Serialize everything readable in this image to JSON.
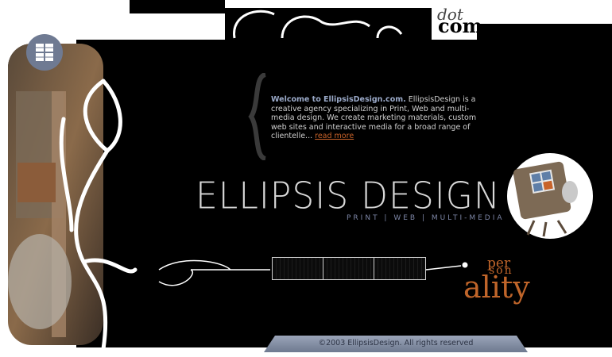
{
  "header": {
    "dot_text": "dot",
    "com_text": "com"
  },
  "welcome": {
    "bold_text": "Welcome to EllipsisDesign.com.",
    "body_text": " EllipsisDesign is a creative agency specializing in Print, Web and multi-media design. We create marketing materials, custom web sites and interactive media for a broad range of clientelle... ",
    "link_text": "read more"
  },
  "brand": {
    "name": "ELLIPSIS DESIGN",
    "tagline": "PRINT | WEB | MULTI-MEDIA"
  },
  "personality": {
    "line1": "per",
    "line2": "son",
    "line3": "ality"
  },
  "footer": {
    "copyright": "©2003 EllipsisDesign. All rights reserved"
  },
  "icons": {
    "menu": "grid-window-icon",
    "bracket": "curly-brace-icon",
    "robot": "robot-box-icon"
  },
  "colors": {
    "accent_orange": "#c0652a",
    "accent_blue": "#7d86a6",
    "footer_bar": "#8e98ad"
  }
}
